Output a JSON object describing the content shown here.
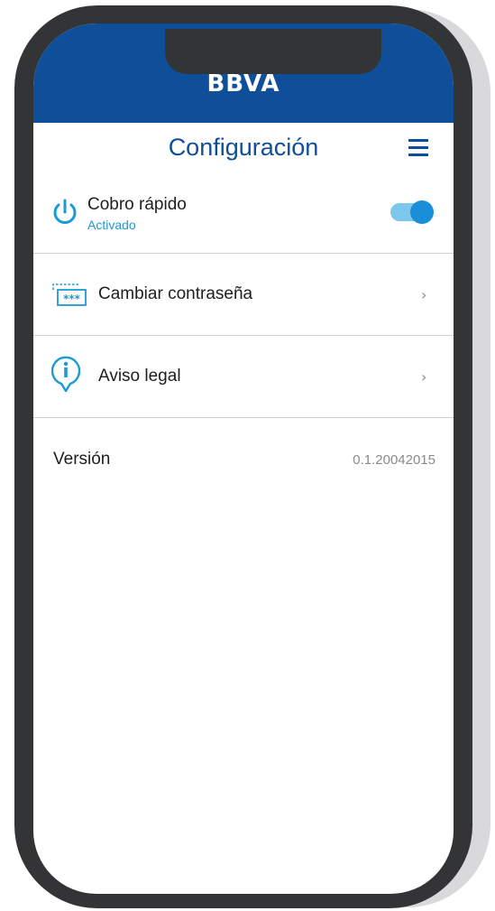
{
  "app": {
    "brand": "BBVA",
    "accent_color": "#0f4f9a",
    "link_color": "#1a9ad6"
  },
  "header": {
    "title": "Configuración",
    "menu_icon": "hamburger-menu-icon"
  },
  "settings": {
    "quick_charge": {
      "label": "Cobro rápido",
      "status": "Activado",
      "icon": "power-icon",
      "enabled": true
    },
    "change_password": {
      "label": "Cambiar contraseña",
      "icon": "password-field-icon",
      "chevron": "›"
    },
    "legal_notice": {
      "label": "Aviso legal",
      "icon": "info-icon",
      "chevron": "›"
    }
  },
  "version": {
    "label": "Versión",
    "value": "0.1.20042015"
  }
}
